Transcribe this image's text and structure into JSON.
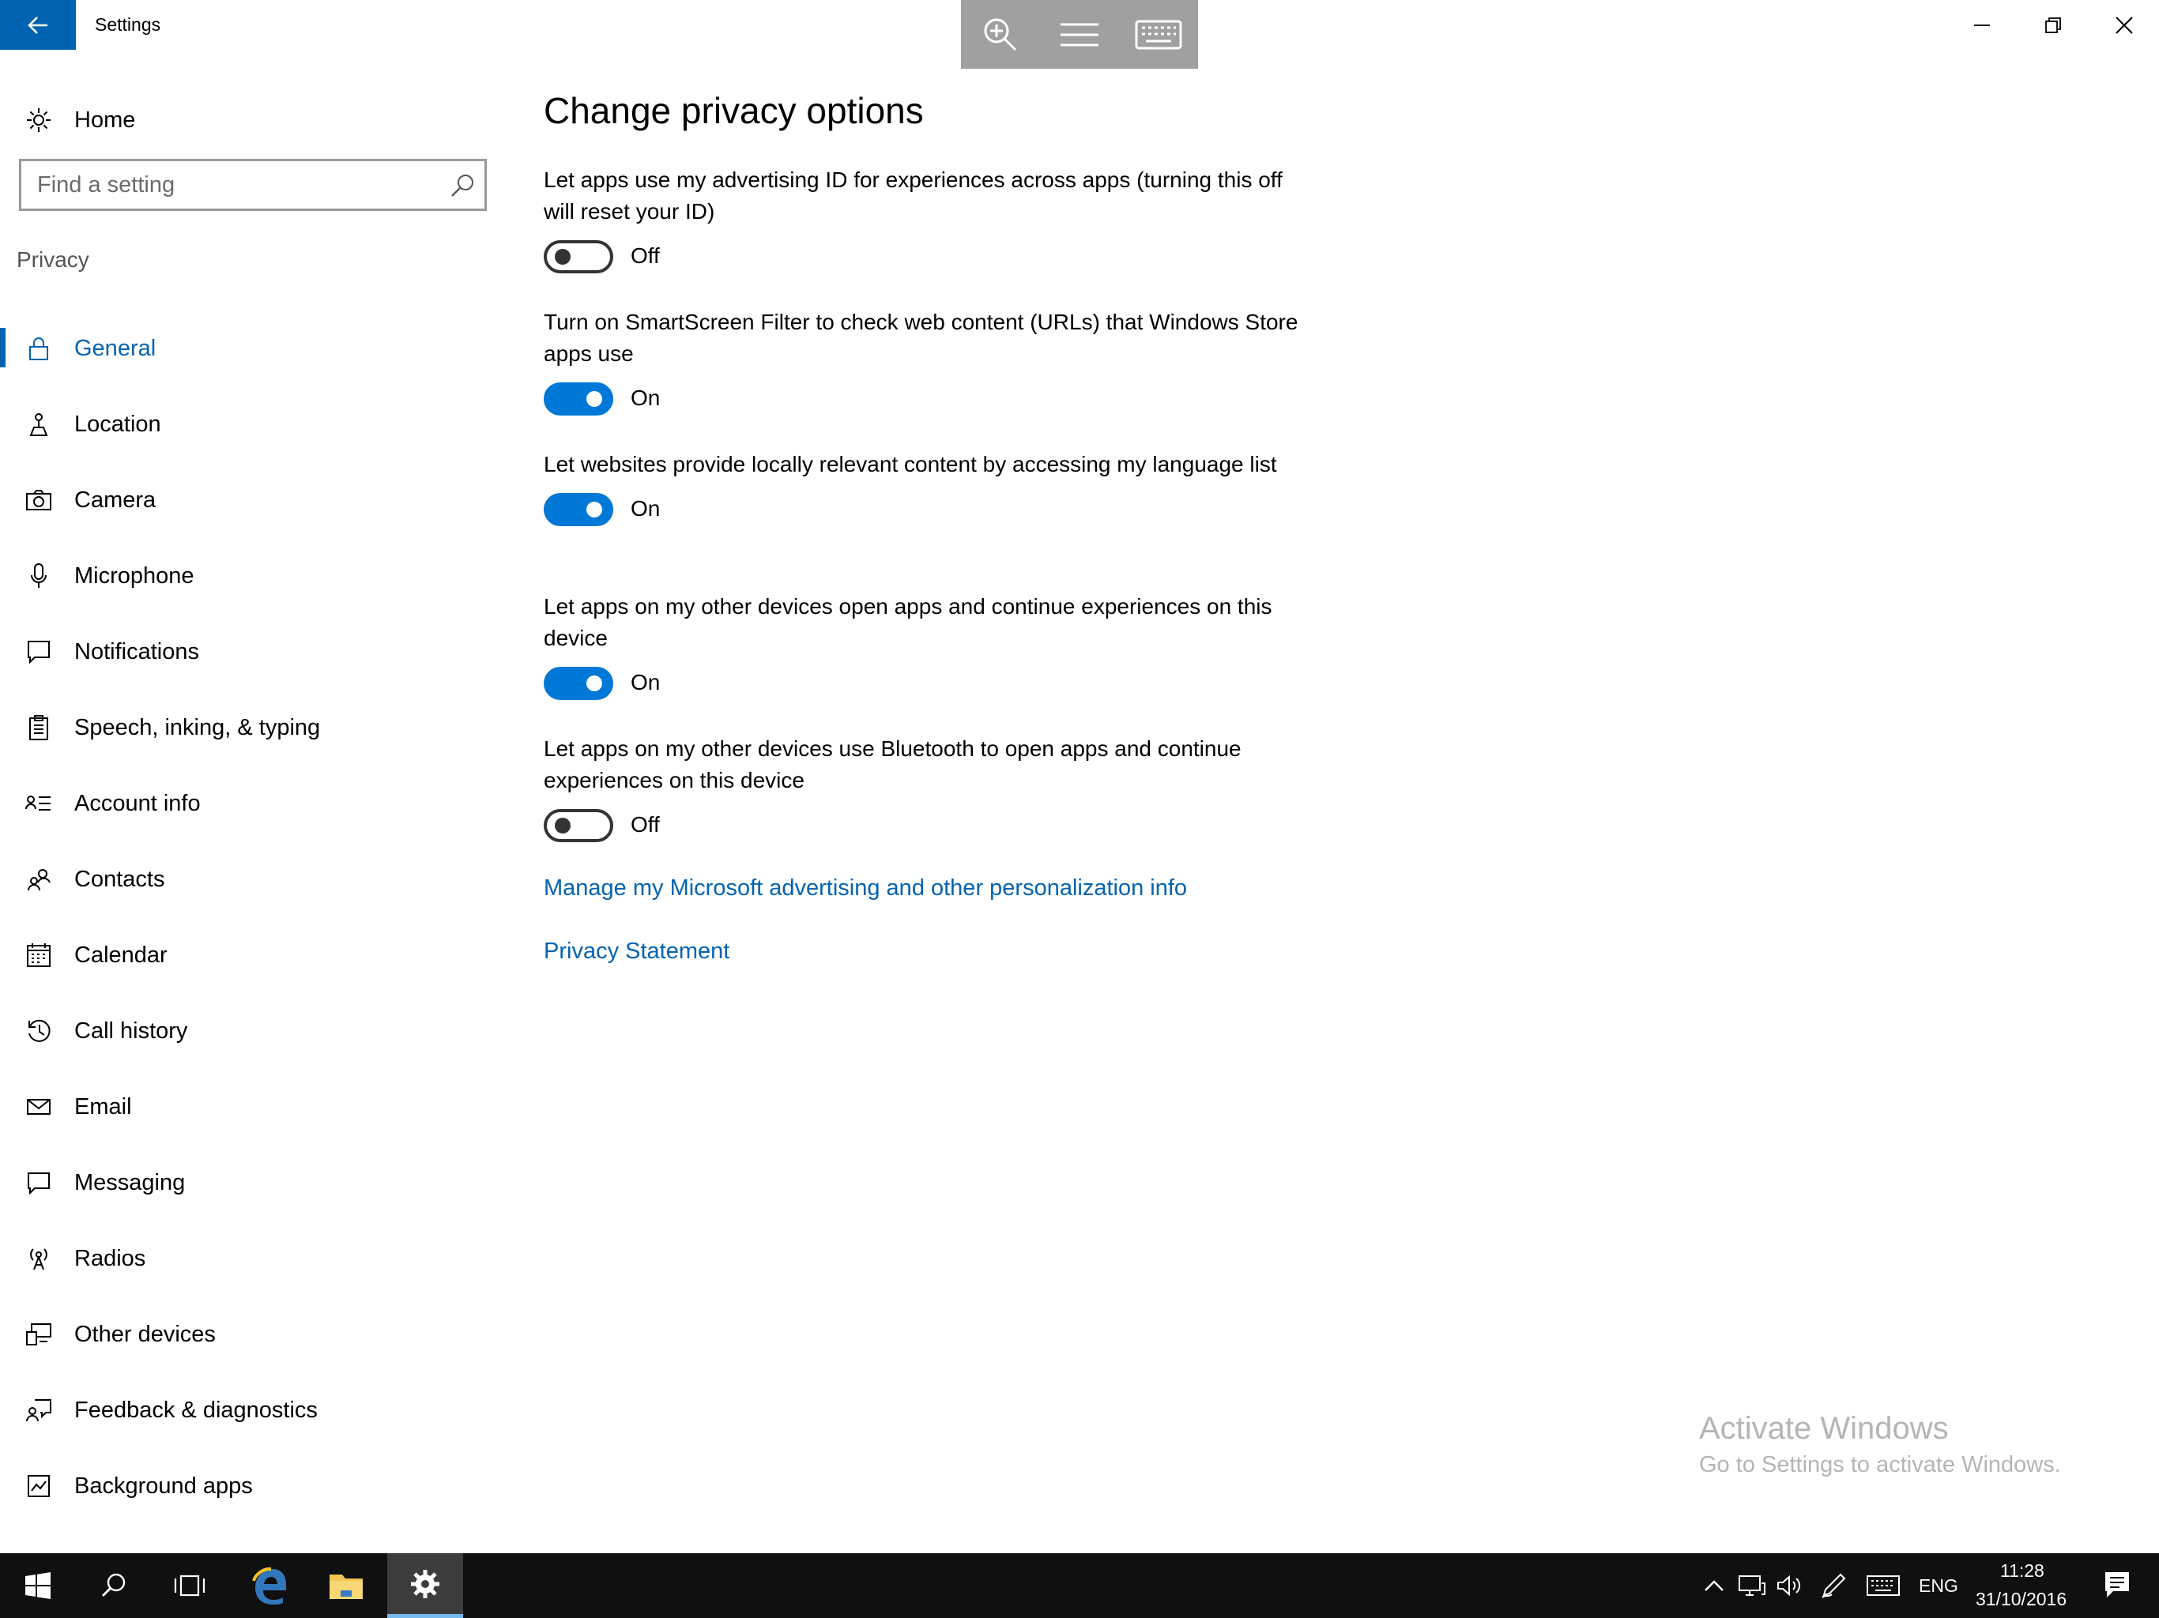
{
  "window": {
    "title": "Settings"
  },
  "float_toolbar": {
    "icons": [
      "zoom-in-icon",
      "menu-icon",
      "keyboard-icon"
    ]
  },
  "sidebar": {
    "home_label": "Home",
    "search_placeholder": "Find a setting",
    "section_title": "Privacy",
    "items": [
      {
        "label": "General",
        "icon": "lock-icon",
        "active": true
      },
      {
        "label": "Location",
        "icon": "location-icon"
      },
      {
        "label": "Camera",
        "icon": "camera-icon"
      },
      {
        "label": "Microphone",
        "icon": "microphone-icon"
      },
      {
        "label": "Notifications",
        "icon": "notifications-icon"
      },
      {
        "label": "Speech, inking, & typing",
        "icon": "speech-icon"
      },
      {
        "label": "Account info",
        "icon": "account-info-icon"
      },
      {
        "label": "Contacts",
        "icon": "contacts-icon"
      },
      {
        "label": "Calendar",
        "icon": "calendar-icon"
      },
      {
        "label": "Call history",
        "icon": "call-history-icon"
      },
      {
        "label": "Email",
        "icon": "email-icon"
      },
      {
        "label": "Messaging",
        "icon": "messaging-icon"
      },
      {
        "label": "Radios",
        "icon": "radios-icon"
      },
      {
        "label": "Other devices",
        "icon": "other-devices-icon"
      },
      {
        "label": "Feedback & diagnostics",
        "icon": "feedback-icon"
      },
      {
        "label": "Background apps",
        "icon": "background-apps-icon"
      }
    ]
  },
  "main": {
    "title": "Change privacy options",
    "settings": [
      {
        "desc": "Let apps use my advertising ID for experiences across apps (turning this off will reset your ID)",
        "state": "Off",
        "on": false
      },
      {
        "desc": "Turn on SmartScreen Filter to check web content (URLs) that Windows Store apps use",
        "state": "On",
        "on": true
      },
      {
        "desc": "Let websites provide locally relevant content by accessing my language list",
        "state": "On",
        "on": true
      },
      {
        "desc": "Let apps on my other devices open apps and continue experiences on this device",
        "state": "On",
        "on": true
      },
      {
        "desc": "Let apps on my other devices use Bluetooth to open apps and continue experiences on this device",
        "state": "Off",
        "on": false
      }
    ],
    "links": {
      "manage": "Manage my Microsoft advertising and other personalization info",
      "privacy": "Privacy Statement"
    }
  },
  "watermark": {
    "title": "Activate Windows",
    "subtitle": "Go to Settings to activate Windows."
  },
  "taskbar": {
    "language": "ENG",
    "time": "11:28",
    "date": "31/10/2016",
    "notification_count": "1",
    "accent_color": "#0078d7"
  }
}
